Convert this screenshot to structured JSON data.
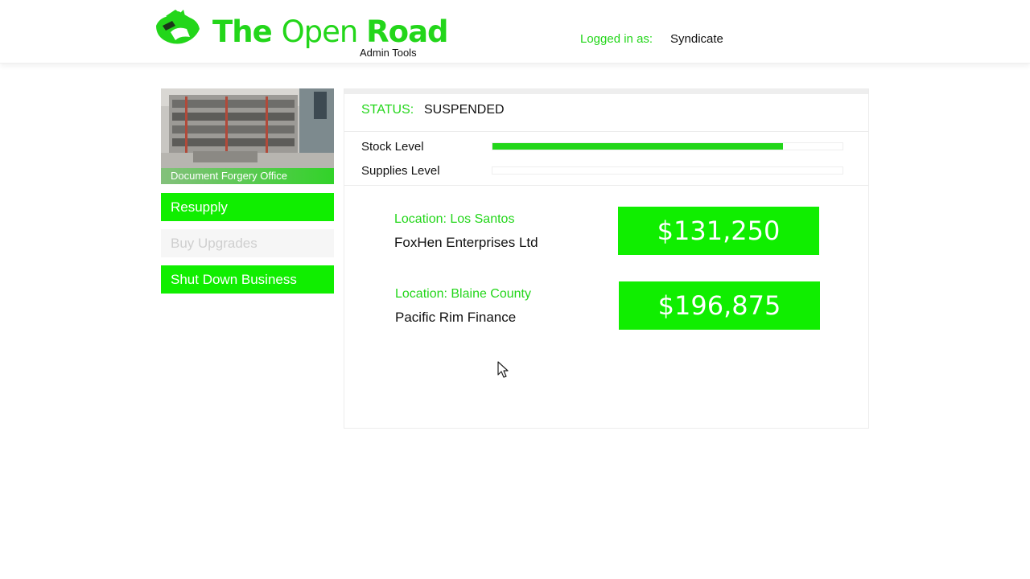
{
  "header": {
    "logo_title_part1": "The ",
    "logo_title_part2": "Open ",
    "logo_title_part3": "Road",
    "logo_subtitle": "Admin Tools",
    "login_label": "Logged in as:",
    "login_user": "Syndicate"
  },
  "sidebar": {
    "business_name": "Document Forgery Office",
    "buttons": [
      {
        "label": "Resupply",
        "state": "active"
      },
      {
        "label": "Buy Upgrades",
        "state": "disabled"
      },
      {
        "label": "Shut Down Business",
        "state": "active"
      }
    ]
  },
  "status": {
    "label": "STATUS:",
    "value": "SUSPENDED"
  },
  "meters": [
    {
      "label": "Stock Level",
      "fraction": 0.83
    },
    {
      "label": "Supplies Level",
      "fraction": 0.0
    }
  ],
  "sales": [
    {
      "location": "Location: Los Santos",
      "company": "FoxHen Enterprises Ltd",
      "price": "$131,250"
    },
    {
      "location": "Location: Blaine County",
      "company": "Pacific Rim Finance",
      "price": "$196,875"
    }
  ],
  "colors": {
    "accent": "#23d61a",
    "button": "#10ee00",
    "disabled_bg": "#f6f6f6",
    "disabled_text": "#cfcfcf"
  },
  "icons": {
    "logo": "mountain-road-logo-icon",
    "cursor": "mouse-pointer-icon"
  }
}
